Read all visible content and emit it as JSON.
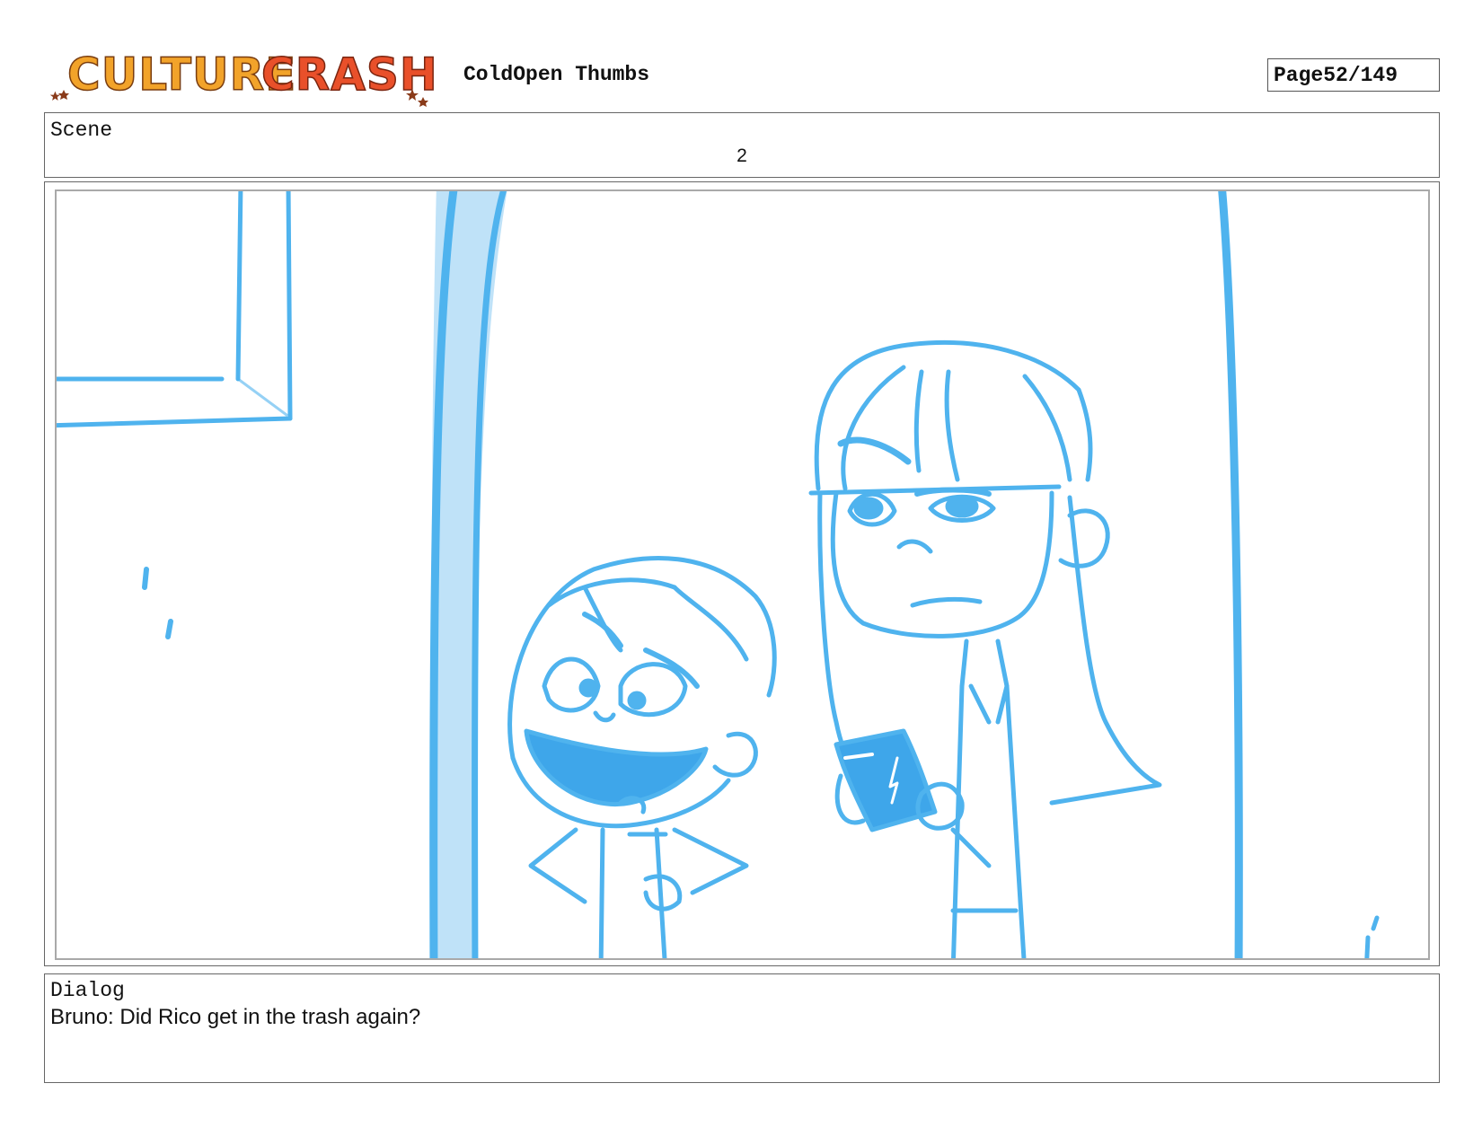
{
  "header": {
    "logo_text_part1": "CULTURE",
    "logo_text_part2": "CRASH",
    "title": "ColdOpen Thumbs",
    "page_label": "Page",
    "page_value": "52/149"
  },
  "scene": {
    "label": "Scene",
    "number": "2"
  },
  "panel": {
    "sketch_color": "#4fb3ee"
  },
  "dialog": {
    "label": "Dialog",
    "text": "Bruno: Did Rico get in the trash again?"
  },
  "colors": {
    "logo_orange": "#f2a32a",
    "logo_red": "#e9502a",
    "border": "#666666"
  }
}
